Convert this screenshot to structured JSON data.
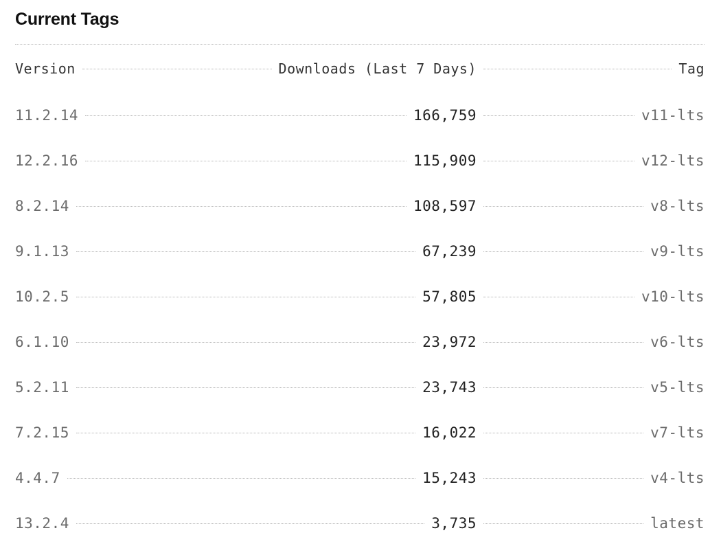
{
  "section": {
    "title": "Current Tags"
  },
  "table": {
    "headers": {
      "version": "Version",
      "downloads": "Downloads (Last 7 Days)",
      "tag": "Tag"
    },
    "rows": [
      {
        "version": "11.2.14",
        "downloads": "166,759",
        "tag": "v11-lts"
      },
      {
        "version": "12.2.16",
        "downloads": "115,909",
        "tag": "v12-lts"
      },
      {
        "version": "8.2.14",
        "downloads": "108,597",
        "tag": "v8-lts"
      },
      {
        "version": "9.1.13",
        "downloads": "67,239",
        "tag": "v9-lts"
      },
      {
        "version": "10.2.5",
        "downloads": "57,805",
        "tag": "v10-lts"
      },
      {
        "version": "6.1.10",
        "downloads": "23,972",
        "tag": "v6-lts"
      },
      {
        "version": "5.2.11",
        "downloads": "23,743",
        "tag": "v5-lts"
      },
      {
        "version": "7.2.15",
        "downloads": "16,022",
        "tag": "v7-lts"
      },
      {
        "version": "4.4.7",
        "downloads": "15,243",
        "tag": "v4-lts"
      },
      {
        "version": "13.2.4",
        "downloads": "3,735",
        "tag": "latest"
      }
    ]
  },
  "colors": {
    "title": "#111111",
    "header_text": "#333333",
    "version_text": "#6b6b6b",
    "downloads_text": "#222222",
    "leader_dots": "#b5b5b5"
  }
}
